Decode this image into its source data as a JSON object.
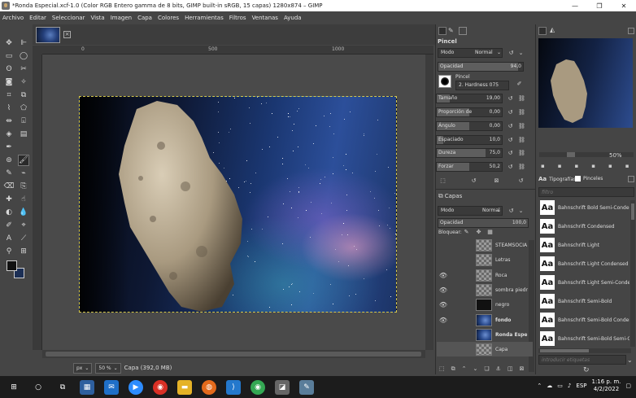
{
  "window": {
    "title": "*Ronda Especial.xcf-1.0 (Color RGB Entero gamma de 8 bits, GIMP built-in sRGB, 15 capas) 1280x874 – GIMP",
    "min": "—",
    "max": "❐",
    "close": "✕"
  },
  "menu": [
    "Archivo",
    "Editar",
    "Seleccionar",
    "Vista",
    "Imagen",
    "Capa",
    "Colores",
    "Herramientas",
    "Filtros",
    "Ventanas",
    "Ayuda"
  ],
  "ruler": [
    "0",
    "500",
    "1000"
  ],
  "status": {
    "unit": "px",
    "zoom": "50 %",
    "info": "Capa (392,0 MB)"
  },
  "brush_panel": {
    "title": "Pincel",
    "mode_label": "Modo",
    "mode_value": "Normal",
    "opacity_label": "Opacidad",
    "opacity_value": "94,0",
    "brush_label": "Pincel",
    "brush_name": "2. Hardness 075",
    "options": [
      {
        "label": "Tamaño",
        "value": "19,00",
        "fill": 0.2
      },
      {
        "label": "Proporción de",
        "value": "0,00",
        "fill": 0.5
      },
      {
        "label": "Ángulo",
        "value": "0,00",
        "fill": 0.5
      },
      {
        "label": "Espaciado",
        "value": "10,0",
        "fill": 0.1
      },
      {
        "label": "Dureza",
        "value": "75,0",
        "fill": 0.75
      },
      {
        "label": "Forzar",
        "value": "50,2",
        "fill": 0.5
      }
    ]
  },
  "layers_panel": {
    "title": "Capas",
    "mode_label": "Modo",
    "mode_value": "Normal",
    "opacity_label": "Opacidad",
    "opacity_value": "100,0",
    "lock_label": "Bloquear:",
    "layers": [
      {
        "name": "STEAMSOCIA",
        "visible": false,
        "bold": false,
        "thumb": "checker"
      },
      {
        "name": "Letras",
        "visible": false,
        "bold": false,
        "thumb": "checker"
      },
      {
        "name": "Roca",
        "visible": true,
        "bold": false,
        "thumb": "checker"
      },
      {
        "name": "sombra piedr",
        "visible": true,
        "bold": false,
        "thumb": "checker"
      },
      {
        "name": "negro",
        "visible": true,
        "bold": false,
        "thumb": "dark"
      },
      {
        "name": "fondo",
        "visible": true,
        "bold": true,
        "thumb": "space"
      },
      {
        "name": "Ronda Espe",
        "visible": false,
        "bold": true,
        "thumb": "space"
      },
      {
        "name": "Capa",
        "visible": false,
        "bold": false,
        "thumb": "checker"
      }
    ]
  },
  "navigator": {
    "zoom": "50%"
  },
  "fonts_panel": {
    "tab1": "Tipografías",
    "tab2": "Pinceles",
    "filter_placeholder": "filtro",
    "tags_placeholder": "introducir etiquetas",
    "fonts": [
      "Bahnschrift Bold Semi-Condensed",
      "Bahnschrift Condensed",
      "Bahnschrift Light",
      "Bahnschrift Light Condensed",
      "Bahnschrift Light Semi-Condensed",
      "Bahnschrift Semi-Bold",
      "Bahnschrift Semi-Bold Condensed",
      "Bahnschrift Semi-Bold Semi-Condensed"
    ],
    "aa": "Aa"
  },
  "taskbar": {
    "time": "1:16 p. m.",
    "date": "4/2/2022",
    "lang": "ESP"
  }
}
